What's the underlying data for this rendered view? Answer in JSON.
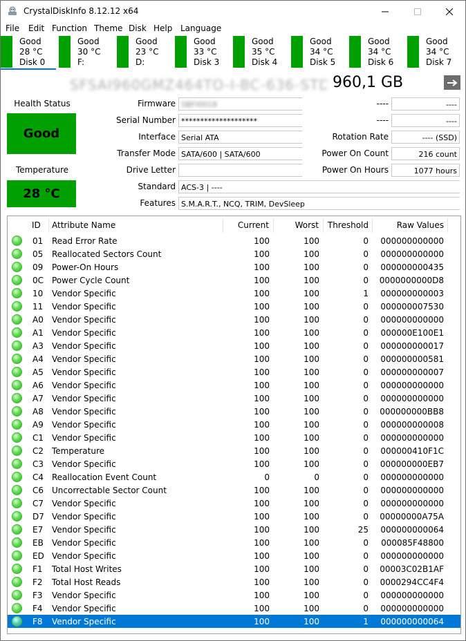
{
  "window": {
    "title": "CrystalDiskInfo 8.12.12 x64"
  },
  "menu": [
    "File",
    "Edit",
    "Function",
    "Theme",
    "Disk",
    "Help",
    "Language"
  ],
  "disk_tabs": [
    {
      "status": "Good",
      "temp": "28 °C",
      "name": "Disk 0",
      "active": true
    },
    {
      "status": "Good",
      "temp": "30 °C",
      "name": "F:"
    },
    {
      "status": "Good",
      "temp": "23 °C",
      "name": "D:"
    },
    {
      "status": "Good",
      "temp": "33 °C",
      "name": "Disk 3"
    },
    {
      "status": "Good",
      "temp": "35 °C",
      "name": "Disk 4"
    },
    {
      "status": "Good",
      "temp": "34 °C",
      "name": "Disk 5"
    },
    {
      "status": "Good",
      "temp": "34 °C",
      "name": "Disk 6"
    },
    {
      "status": "Good",
      "temp": "34 °C",
      "name": "Disk 7"
    }
  ],
  "drive": {
    "model": "SFSAI960GMZ464TO-I-BC-636-STD",
    "capacity": "960,1 GB",
    "health_label": "Health Status",
    "health_value": "Good",
    "temp_label": "Temperature",
    "temp_value": "28 °C",
    "firmware_label": "Firmware",
    "firmware_value": "SBFI0018",
    "serial_label": "Serial Number",
    "serial_value": "********************",
    "interface_label": "Interface",
    "interface_value": "Serial ATA",
    "transfer_label": "Transfer Mode",
    "transfer_value": "SATA/600 | SATA/600",
    "letter_label": "Drive Letter",
    "letter_value": "",
    "standard_label": "Standard",
    "standard_value": "ACS-3 | ----",
    "features_label": "Features",
    "features_value": "S.M.A.R.T., NCQ, TRIM, DevSleep",
    "right_blank1_value": "----",
    "right_blank2_value": "----",
    "right_blank1_b": "----",
    "right_blank2_b": "----",
    "rotation_label": "Rotation Rate",
    "rotation_value": "---- (SSD)",
    "poc_label": "Power On Count",
    "poc_value": "216 count",
    "poh_label": "Power On Hours",
    "poh_value": "1077 hours"
  },
  "colors": {
    "good": "#00a000",
    "selection": "#0078d7"
  },
  "table": {
    "headers": [
      "ID",
      "Attribute Name",
      "Current",
      "Worst",
      "Threshold",
      "Raw Values"
    ],
    "rows": [
      [
        "01",
        "Read Error Rate",
        "100",
        "100",
        "0",
        "000000000000"
      ],
      [
        "05",
        "Reallocated Sectors Count",
        "100",
        "100",
        "0",
        "000000000000"
      ],
      [
        "09",
        "Power-On Hours",
        "100",
        "100",
        "0",
        "000000000435"
      ],
      [
        "0C",
        "Power Cycle Count",
        "100",
        "100",
        "0",
        "0000000000D8"
      ],
      [
        "10",
        "Vendor Specific",
        "100",
        "100",
        "1",
        "000000000003"
      ],
      [
        "11",
        "Vendor Specific",
        "100",
        "100",
        "0",
        "000000007530"
      ],
      [
        "A0",
        "Vendor Specific",
        "100",
        "100",
        "0",
        "000000000000"
      ],
      [
        "A1",
        "Vendor Specific",
        "100",
        "100",
        "0",
        "000000E100E1"
      ],
      [
        "A3",
        "Vendor Specific",
        "100",
        "100",
        "0",
        "000000000017"
      ],
      [
        "A4",
        "Vendor Specific",
        "100",
        "100",
        "0",
        "000000000581"
      ],
      [
        "A5",
        "Vendor Specific",
        "100",
        "100",
        "0",
        "000000000007"
      ],
      [
        "A6",
        "Vendor Specific",
        "100",
        "100",
        "0",
        "000000000000"
      ],
      [
        "A7",
        "Vendor Specific",
        "100",
        "100",
        "0",
        "000000000000"
      ],
      [
        "A8",
        "Vendor Specific",
        "100",
        "100",
        "0",
        "000000000BB8"
      ],
      [
        "A9",
        "Vendor Specific",
        "100",
        "100",
        "0",
        "000000000008"
      ],
      [
        "C1",
        "Vendor Specific",
        "100",
        "100",
        "0",
        "000000000000"
      ],
      [
        "C2",
        "Temperature",
        "100",
        "100",
        "0",
        "000000410F1C"
      ],
      [
        "C3",
        "Vendor Specific",
        "100",
        "100",
        "0",
        "000000000EB7"
      ],
      [
        "C4",
        "Reallocation Event Count",
        "0",
        "0",
        "0",
        "000000000000"
      ],
      [
        "C6",
        "Uncorrectable Sector Count",
        "100",
        "100",
        "0",
        "000000000000"
      ],
      [
        "C7",
        "Vendor Specific",
        "100",
        "100",
        "0",
        "000000000000"
      ],
      [
        "D7",
        "Vendor Specific",
        "100",
        "100",
        "0",
        "00000000A75A"
      ],
      [
        "E7",
        "Vendor Specific",
        "100",
        "100",
        "25",
        "000000000064"
      ],
      [
        "EB",
        "Vendor Specific",
        "100",
        "100",
        "0",
        "000085F48800"
      ],
      [
        "ED",
        "Vendor Specific",
        "100",
        "100",
        "0",
        "000000000000"
      ],
      [
        "F1",
        "Total Host Writes",
        "100",
        "100",
        "0",
        "00003C02B1AF"
      ],
      [
        "F2",
        "Total Host Reads",
        "100",
        "100",
        "0",
        "0000294CC4F4"
      ],
      [
        "F3",
        "Vendor Specific",
        "100",
        "100",
        "0",
        "000000000000"
      ],
      [
        "F4",
        "Vendor Specific",
        "100",
        "100",
        "0",
        "000000000000"
      ],
      [
        "F8",
        "Vendor Specific",
        "100",
        "100",
        "1",
        "000000000064"
      ]
    ],
    "selected_index": 29
  }
}
